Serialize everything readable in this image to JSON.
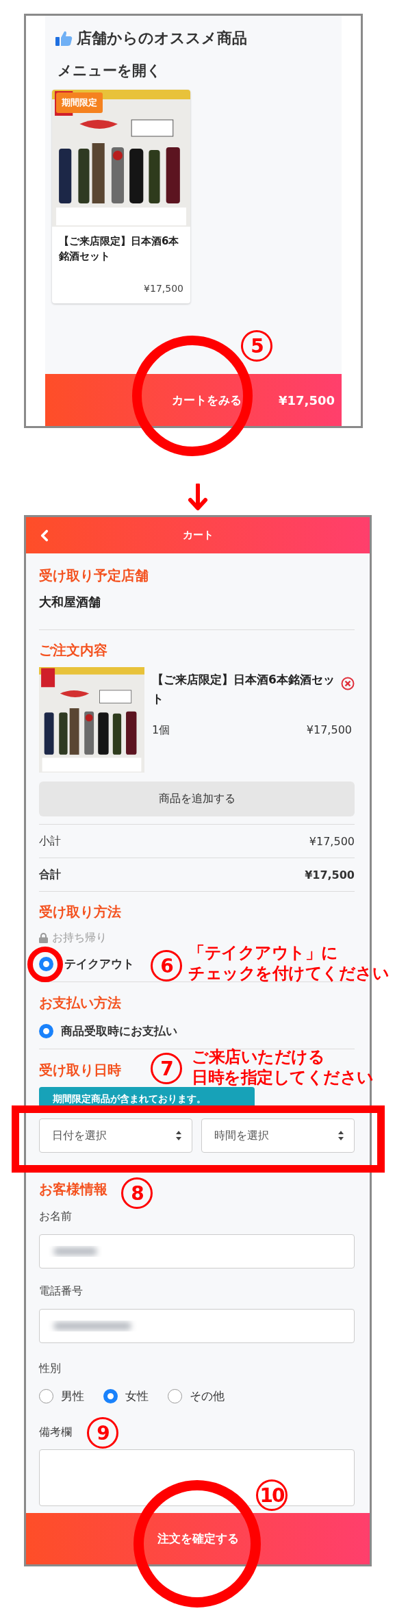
{
  "menu_screen": {
    "recommend_title": "店舗からのオススメ商品",
    "menu_link": "メニューを開く",
    "product": {
      "badge": "期間限定",
      "title": "【ご来店限定】日本酒6本銘酒セット",
      "price": "¥17,500"
    },
    "cart_bar": {
      "label": "カートをみる",
      "total": "¥17,500"
    }
  },
  "cart_screen": {
    "header_title": "カート",
    "store": {
      "heading": "受け取り予定店舗",
      "name": "大和屋酒舗"
    },
    "order": {
      "heading": "ご注文内容",
      "items": [
        {
          "title": "【ご来店限定】日本酒6本銘酒セット",
          "quantity": "1個",
          "price": "¥17,500"
        }
      ],
      "add_button": "商品を追加する"
    },
    "totals": [
      {
        "kind": "subtotal",
        "label": "小計",
        "value": "¥17,500"
      },
      {
        "kind": "total",
        "label": "合計",
        "value": "¥17,500"
      }
    ],
    "pickup": {
      "heading": "受け取り方法",
      "group_label": "お持ち帰り",
      "options": [
        {
          "label": "テイクアウト",
          "selected": true
        }
      ]
    },
    "payment": {
      "heading": "お支払い方法",
      "options": [
        {
          "label": "商品受取時にお支払い",
          "selected": true
        }
      ]
    },
    "pickup_time": {
      "heading": "受け取り日時",
      "notice": "期間限定商品が含まれております。",
      "selects": [
        {
          "value": "日付を選択"
        },
        {
          "value": "時間を選択"
        }
      ]
    },
    "customer": {
      "heading": "お客様情報",
      "fields": [
        {
          "label": "お名前",
          "redacted": true
        },
        {
          "label": "電話番号",
          "redacted": true
        }
      ],
      "gender": {
        "label": "性別",
        "options": [
          {
            "label": "男性",
            "selected": false
          },
          {
            "label": "女性",
            "selected": true
          },
          {
            "label": "その他",
            "selected": false
          }
        ]
      },
      "notes": {
        "label": "備考欄"
      }
    },
    "submit": "注文を確定する"
  },
  "annotations": {
    "steps": [
      "5",
      "6",
      "7",
      "8",
      "9",
      "10"
    ],
    "callouts": [
      {
        "lines": [
          "「テイクアウト」に",
          "チェックを付けてください"
        ]
      },
      {
        "lines": [
          "ご来店いただける",
          "日時を指定してください"
        ]
      }
    ]
  }
}
